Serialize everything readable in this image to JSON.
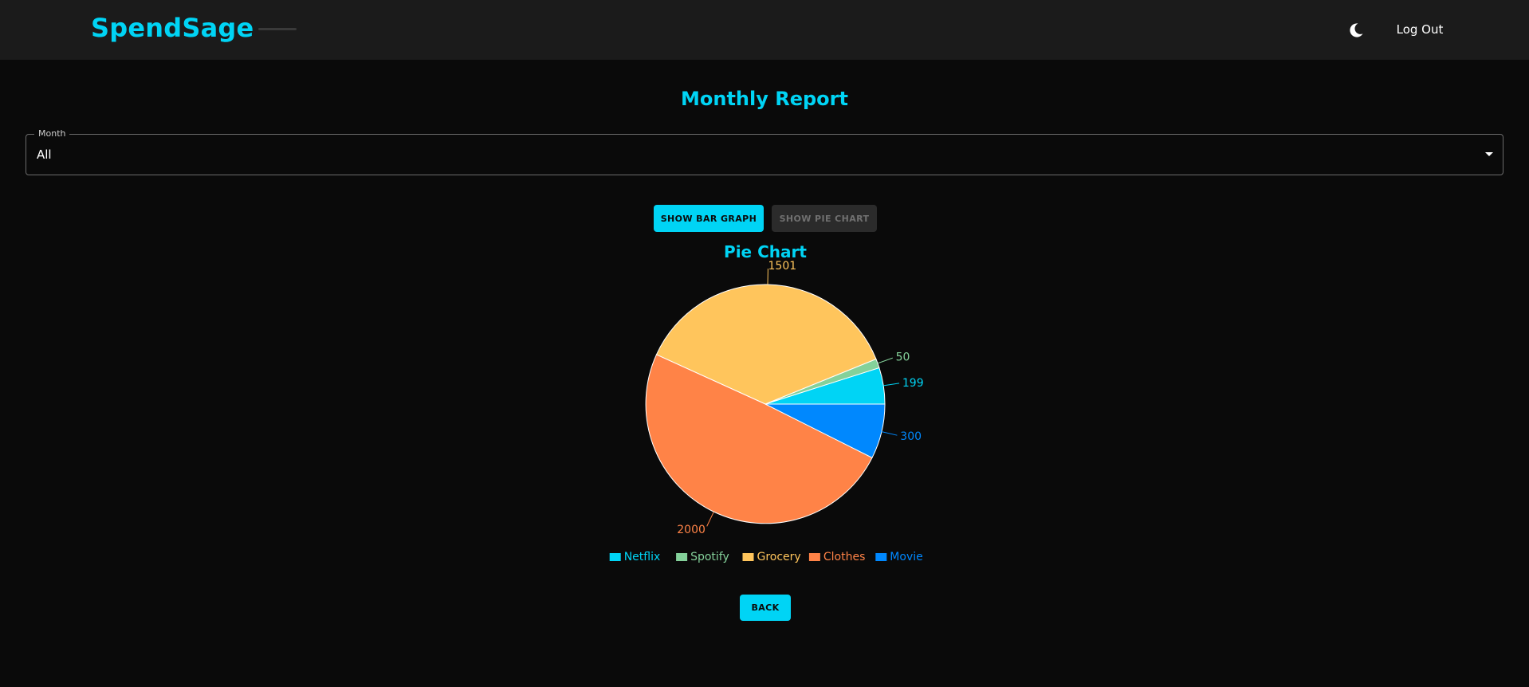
{
  "header": {
    "brand": "SpendSage",
    "logout_label": "Log Out",
    "theme_icon": "moon-icon"
  },
  "page": {
    "title": "Monthly Report"
  },
  "month_select": {
    "label": "Month",
    "value": "All"
  },
  "buttons": {
    "show_bar": "SHOW BAR GRAPH",
    "show_pie": "SHOW PIE CHART",
    "back": "BACK"
  },
  "colors": {
    "accent": "#00d4f5",
    "background": "#0a0a0a",
    "header": "#1b1b1b"
  },
  "chart_data": {
    "type": "pie",
    "title": "Pie Chart",
    "categories": [
      "Netflix",
      "Spotify",
      "Grocery",
      "Clothes",
      "Movie"
    ],
    "values": [
      199,
      50,
      1501,
      2000,
      300
    ],
    "colors": [
      "#00d4f5",
      "#84d19a",
      "#ffc55c",
      "#ff8347",
      "#0088fe"
    ],
    "data_labels": true,
    "legend": "bottom"
  }
}
